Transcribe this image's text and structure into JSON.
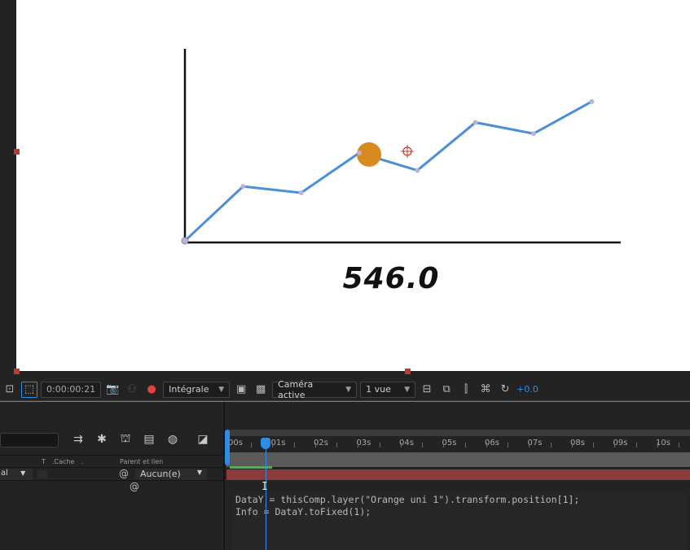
{
  "viewer": {
    "readout_value": "546.0"
  },
  "chart_data": {
    "type": "line",
    "x": [
      0,
      1,
      2,
      3,
      4,
      5,
      6,
      7
    ],
    "values": [
      0,
      68,
      60,
      110,
      88,
      148,
      134,
      174
    ],
    "ylim": [
      0,
      240
    ],
    "xlim": [
      0,
      7.5
    ],
    "marker_index": 3,
    "series_color": "#4a8fd8",
    "marker_color": "#d98a1e"
  },
  "viewer_toolbar": {
    "timecode": "0:00:00:21",
    "resolution": "Intégrale",
    "camera": "Caméra active",
    "views": "1 vue",
    "exposure": "+0.0"
  },
  "timeline": {
    "columns": {
      "t": "T",
      "cache": ".Cache",
      "dot": ".",
      "parent": "Parent et lien"
    },
    "layer": {
      "mode": "al",
      "parent": "Aucun(e)"
    },
    "ruler": [
      "00s",
      "01s",
      "02s",
      "03s",
      "04s",
      "05s",
      "06s",
      "07s",
      "08s",
      "09s",
      "10s"
    ],
    "expression": {
      "line1": "DataY = thisComp.layer(\"Orange uni 1\").transform.position[1];",
      "line2": "Info = DataY.toFixed(1);"
    }
  },
  "colors": {
    "accent": "#2e8ce6",
    "layer_bar": "#8e3b3b",
    "work_area": "#3dbb3d"
  }
}
